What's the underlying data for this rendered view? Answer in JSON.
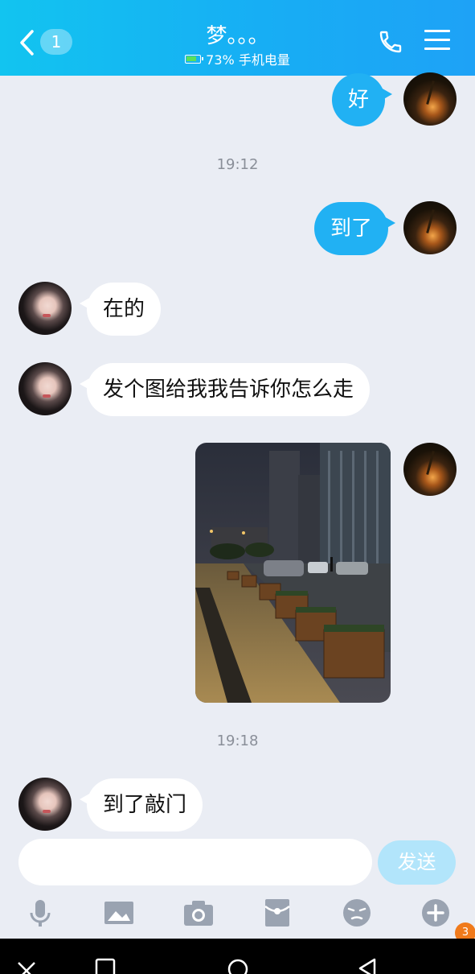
{
  "header": {
    "unread_count": "1",
    "title": "梦。。。",
    "battery_status": "73% 手机电量"
  },
  "messages": [
    {
      "sender": "me",
      "text": "好"
    },
    {
      "timestamp": "19:12"
    },
    {
      "sender": "me",
      "text": "到了"
    },
    {
      "sender": "her",
      "text": "在的"
    },
    {
      "sender": "her",
      "text": "发个图给我我告诉你怎么走"
    },
    {
      "sender": "me",
      "type": "image"
    },
    {
      "timestamp": "19:18"
    },
    {
      "sender": "her",
      "text": "到了敲门"
    }
  ],
  "input": {
    "placeholder": "",
    "send_label": "发送"
  },
  "toolbar_icons": [
    "mic-icon",
    "image-icon",
    "camera-icon",
    "red-packet-icon",
    "emoji-icon",
    "plus-icon"
  ],
  "notification_badge": "3",
  "colors": {
    "header_start": "#12c4f0",
    "header_end": "#1ea2f6",
    "my_bubble": "#21b1f3",
    "send_button_disabled": "#b2e5fb",
    "background": "#eaedf4"
  }
}
